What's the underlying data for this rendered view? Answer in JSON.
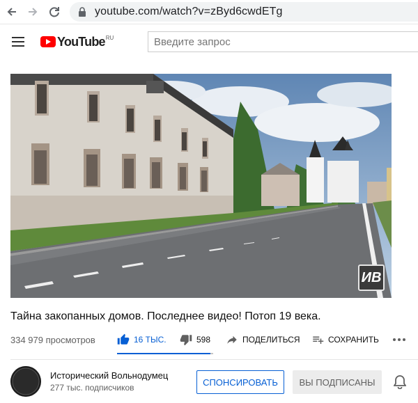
{
  "browser": {
    "url": "youtube.com/watch?v=zByd6cwdETg"
  },
  "header": {
    "logo_text": "YouTube",
    "logo_region": "RU",
    "search_placeholder": "Введите запрос"
  },
  "video": {
    "title": "Тайна закопанных домов. Последнее видео! Потоп 19 века.",
    "views": "334 979 просмотров",
    "watermark": "ИВ",
    "like_ratio": 0.97
  },
  "actions": {
    "likes": "16 ТЫС.",
    "dislikes": "598",
    "share": "ПОДЕЛИТЬСЯ",
    "save": "СОХРАНИТЬ"
  },
  "channel": {
    "name": "Исторический Вольнодумец",
    "subscribers": "277 тыс. подписчиков",
    "avatar_text": "ИСТОРИЧЕСКИЙ ВОЛЬНОДУМЕЦ",
    "sponsor_label": "СПОНСИРОВАТЬ",
    "subscribed_label": "ВЫ ПОДПИСАНЫ"
  },
  "colors": {
    "brand_red": "#ff0000",
    "accent_blue": "#065fd4"
  }
}
